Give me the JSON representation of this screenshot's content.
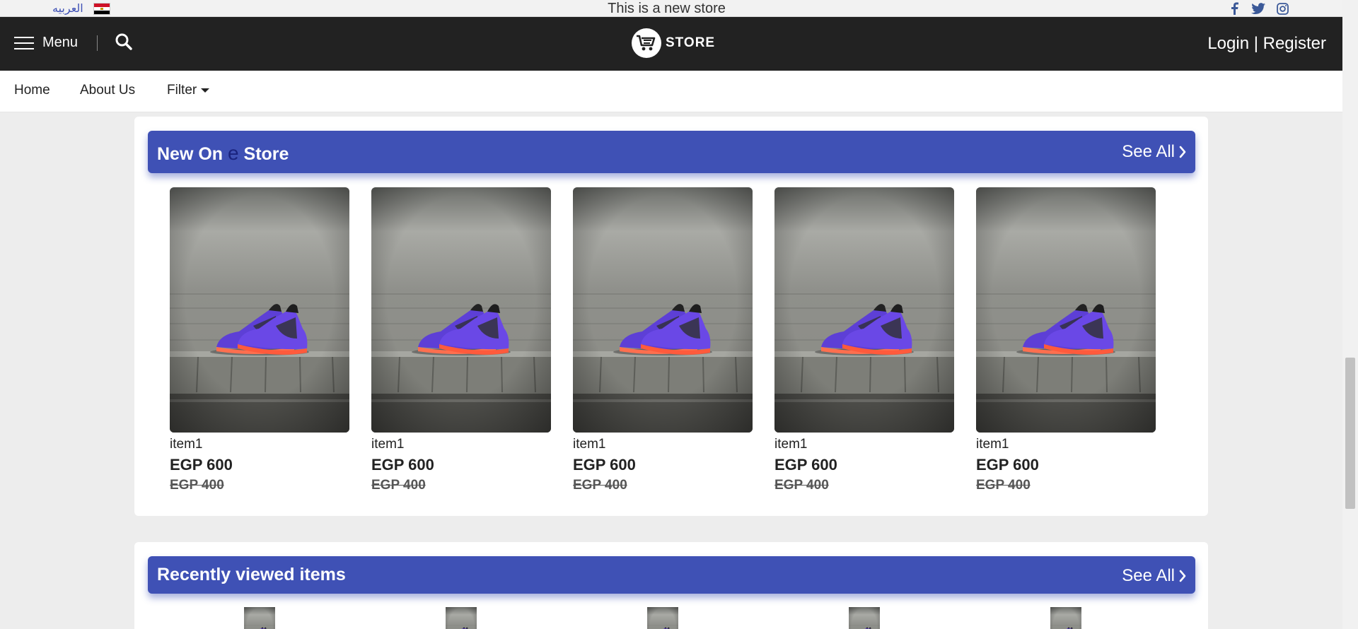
{
  "topbar": {
    "language_label": "العربيه",
    "announcement": "This is a new store",
    "socials": [
      "facebook-icon",
      "twitter-icon",
      "instagram-icon"
    ]
  },
  "header": {
    "menu_label": "Menu",
    "logo_text": "STORE",
    "login_label": "Login",
    "separator": " | ",
    "register_label": "Register"
  },
  "nav": {
    "home": "Home",
    "about": "About Us",
    "filter": "Filter"
  },
  "sections": [
    {
      "title_start": "New On ",
      "title_e": "e",
      "title_end": " Store",
      "see_all": "See All",
      "products": [
        {
          "name": "item1",
          "price": "EGP 600",
          "old_price": "EGP 400"
        },
        {
          "name": "item1",
          "price": "EGP 600",
          "old_price": "EGP 400"
        },
        {
          "name": "item1",
          "price": "EGP 600",
          "old_price": "EGP 400"
        },
        {
          "name": "item1",
          "price": "EGP 600",
          "old_price": "EGP 400"
        },
        {
          "name": "item1",
          "price": "EGP 600",
          "old_price": "EGP 400"
        }
      ]
    },
    {
      "title": "Recently viewed items",
      "see_all": "See All"
    }
  ],
  "colors": {
    "accent": "#3f51b5",
    "header_bg": "#222222",
    "page_bg": "#ededed"
  }
}
